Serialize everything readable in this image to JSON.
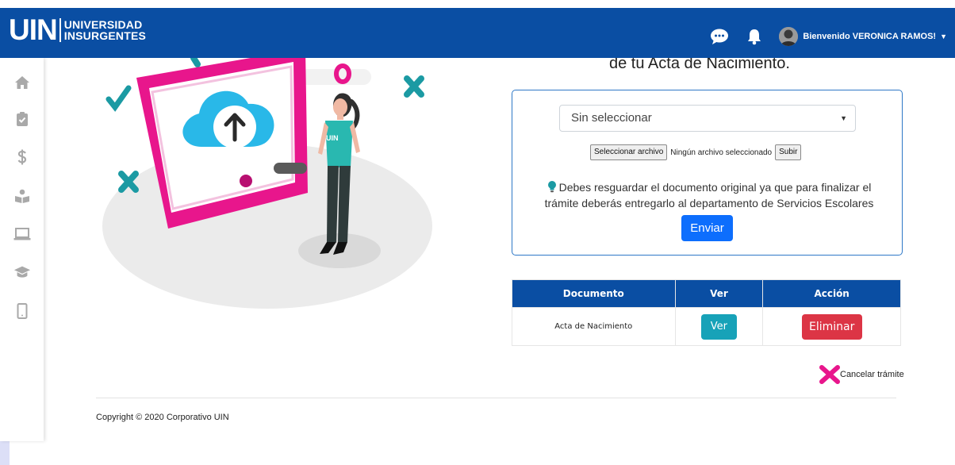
{
  "header": {
    "logo_big": "UIN",
    "logo_line1": "UNIVERSIDAD",
    "logo_line2": "INSURGENTES",
    "welcome": "Bienvenido VERONICA RAMOS!"
  },
  "sidebar": {
    "items": [
      {
        "icon": "home-icon"
      },
      {
        "icon": "clipboard-check-icon"
      },
      {
        "icon": "dollar-icon"
      },
      {
        "icon": "reader-icon"
      },
      {
        "icon": "laptop-icon"
      },
      {
        "icon": "graduation-cap-icon"
      },
      {
        "icon": "tablet-icon"
      }
    ]
  },
  "main": {
    "heading": "de tu Acta de Nacimiento.",
    "illustration_badge": "UIN",
    "upload": {
      "select_value": "Sin seleccionar",
      "file_button": "Seleccionar archivo",
      "file_status": "Ningún archivo seleccionado",
      "upload_button": "Subir",
      "notice": "Debes resguardar el documento original ya que para finalizar el trámite deberás entregarlo al departamento de Servicios Escolares",
      "send_button": "Enviar"
    },
    "table": {
      "headers": [
        "Documento",
        "Ver",
        "Acción"
      ],
      "rows": [
        {
          "documento": "Acta de Nacimiento",
          "ver": "Ver",
          "accion": "Eliminar"
        }
      ]
    },
    "cancel": "Cancelar trámite"
  },
  "footer": {
    "copyright": "Copyright © 2020 Corporativo UIN"
  },
  "colors": {
    "brand_blue": "#0a4ea3",
    "primary_button": "#0d6efd",
    "info_button": "#17a2b8",
    "danger_button": "#dc3545",
    "accent_pink": "#e8168c",
    "illustration_cyan": "#29b8e8"
  }
}
